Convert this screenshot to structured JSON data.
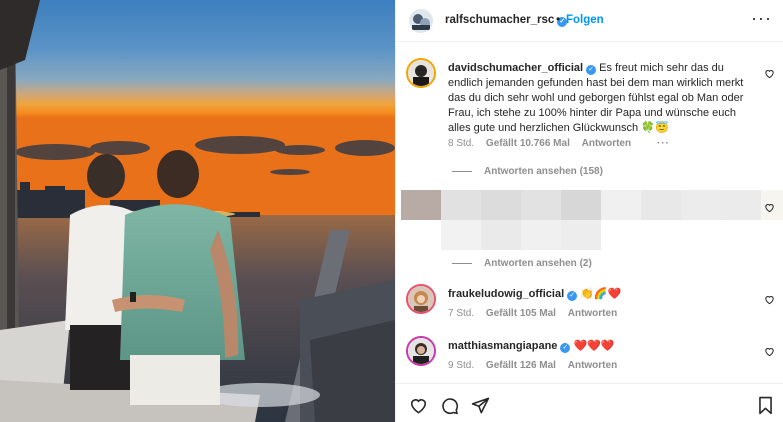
{
  "post": {
    "author": "ralfschumacher_rsc",
    "follow_label": "Folgen",
    "header_separator": "•",
    "more_label": "···"
  },
  "comments": [
    {
      "user": "davidschumacher_official",
      "text": "Es freut mich sehr das du endlich jemanden gefunden hast bei dem man wirklich merkt das du dich sehr wohl und geborgen fühlst egal ob Man oder Frau, ich stehe zu 100% hinter dir Papa und wünsche euch alles gute und herzlichen Glückwunsch",
      "emojis": [
        "🍀",
        "😇"
      ],
      "time": "8 Std.",
      "likes": "Gefällt 10.766 Mal",
      "reply_label": "Antworten",
      "more_label": "···",
      "view_replies": "Antworten ansehen (158)"
    },
    {
      "user": "",
      "text": "",
      "blurred": true,
      "view_replies": "Antworten ansehen (2)"
    },
    {
      "user": "fraukeludowig_official",
      "emojis": [
        "👏",
        "🌈",
        "❤️"
      ],
      "time": "7 Std.",
      "likes": "Gefällt 105 Mal",
      "reply_label": "Antworten"
    },
    {
      "user": "matthiasmangiapane",
      "emojis": [
        "❤️",
        "❤️",
        "❤️"
      ],
      "time": "9 Std.",
      "likes": "Gefällt 126 Mal",
      "reply_label": "Antworten"
    }
  ],
  "icons": {
    "verified": "verified-badge-icon",
    "like": "heart-icon",
    "comment": "comment-bubble-icon",
    "share": "paper-plane-icon",
    "save": "bookmark-icon"
  },
  "colors": {
    "accent": "#0095f6",
    "verified": "#3897f0",
    "meta_text": "#8e8e8e",
    "text": "#262626"
  }
}
